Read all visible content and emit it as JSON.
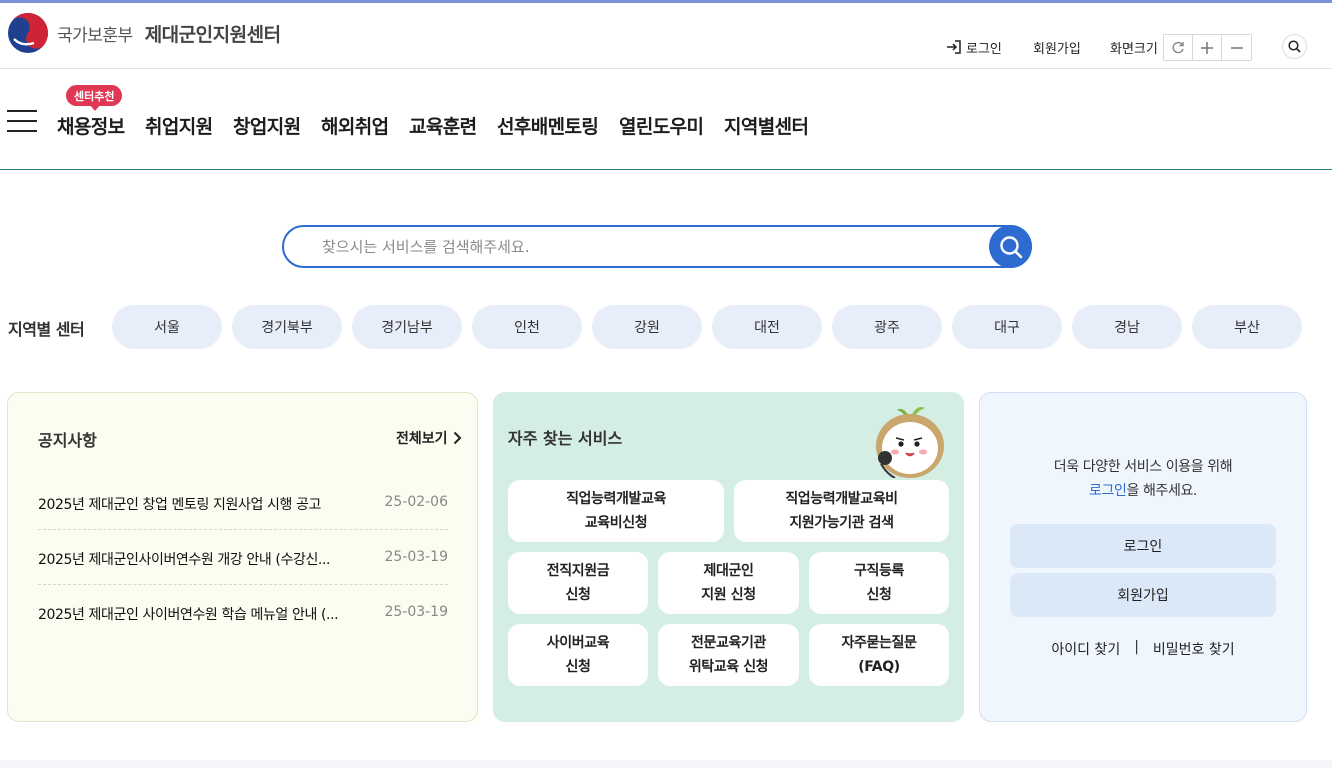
{
  "header": {
    "ministry": "국가보훈부",
    "center_name": "제대군인지원센터",
    "login": "로그인",
    "join": "회원가입",
    "font_size_label": "화면크기",
    "font_size_buttons": [
      "reset-icon",
      "plus-icon",
      "minus-icon"
    ]
  },
  "gnb": {
    "badge": "센터추천",
    "items": [
      "채용정보",
      "취업지원",
      "창업지원",
      "해외취업",
      "교육훈련",
      "선후배멘토링",
      "열린도우미",
      "지역별센터"
    ]
  },
  "search": {
    "placeholder": "찾으시는 서비스를 검색해주세요."
  },
  "regions": {
    "title": "지역별 센터",
    "items": [
      "서울",
      "경기북부",
      "경기남부",
      "인천",
      "강원",
      "대전",
      "광주",
      "대구",
      "경남",
      "부산"
    ]
  },
  "notice": {
    "title": "공지사항",
    "more": "전체보기",
    "items": [
      {
        "text": "2025년 제대군인 창업 멘토링 지원사업 시행 공고",
        "date": "25-02-06"
      },
      {
        "text": "2025년 제대군인사이버연수원 개강 안내 (수강신...",
        "date": "25-03-19"
      },
      {
        "text": "2025년 제대군인 사이버연수원 학습 메뉴얼 안내 (...",
        "date": "25-03-19"
      }
    ]
  },
  "services": {
    "title": "자주 찾는 서비스",
    "items": [
      {
        "line1": "직업능력개발교육",
        "line2": "교육비신청"
      },
      {
        "line1": "직업능력개발교육비",
        "line2": "지원가능기관 검색"
      },
      {
        "line1": "전직지원금",
        "line2": "신청"
      },
      {
        "line1": "제대군인",
        "line2": "지원 신청"
      },
      {
        "line1": "구직등록",
        "line2": "신청"
      },
      {
        "line1": "사이버교육",
        "line2": "신청"
      },
      {
        "line1": "전문교육기관",
        "line2": "위탁교육 신청"
      },
      {
        "line1": "자주묻는질문",
        "line2": "(FAQ)"
      }
    ]
  },
  "login_panel": {
    "msg_line1": "더욱 다양한 서비스 이용을 위해",
    "msg_link": "로그인",
    "msg_suffix": "을 해주세요.",
    "login_button": "로그인",
    "join_button": "회원가입",
    "find_id": "아이디 찾기",
    "separator": "|",
    "find_pw": "비밀번호 찾기"
  },
  "colors": {
    "accent": "#2d6bd1",
    "badge": "#e03755",
    "services_bg": "#d4eee4",
    "notice_bg": "#fbfdf0",
    "login_bg": "#f0f6fd"
  }
}
